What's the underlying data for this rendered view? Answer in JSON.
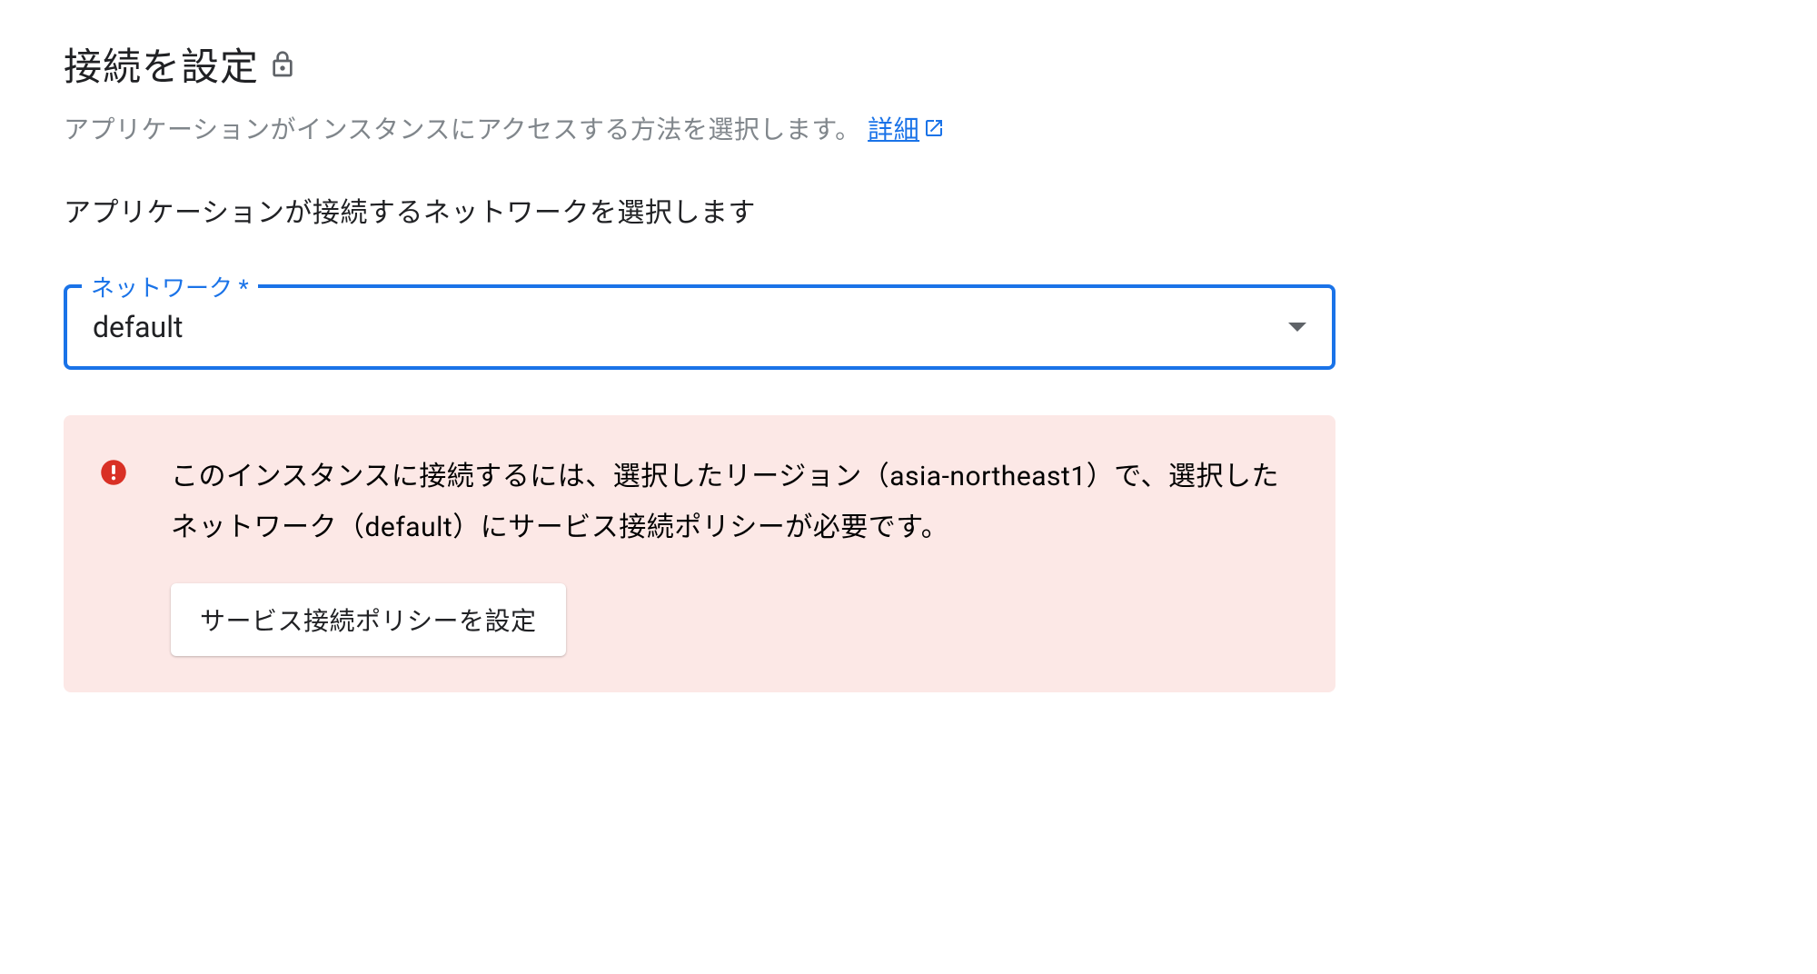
{
  "section": {
    "title": "接続を設定",
    "description": "アプリケーションがインスタンスにアクセスする方法を選択します。",
    "learn_more_label": "詳細",
    "subtitle": "アプリケーションが接続するネットワークを選択します"
  },
  "network_field": {
    "label": "ネットワーク *",
    "value": "default"
  },
  "error": {
    "message": "このインスタンスに接続するには、選択したリージョン（asia-northeast1）で、選択したネットワーク（default）にサービス接続ポリシーが必要です。",
    "action_label": "サービス接続ポリシーを設定"
  }
}
